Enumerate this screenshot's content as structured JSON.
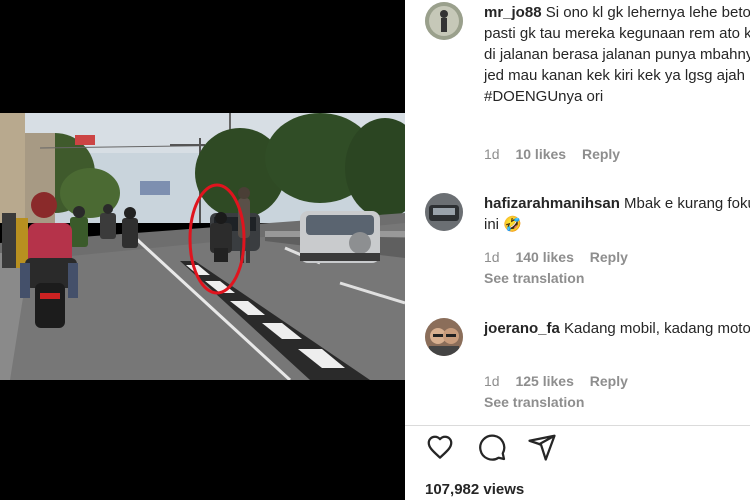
{
  "comments": [
    {
      "username": "mr_jo88",
      "text": "Si ono kl gk lehernya lehe beton pasti gk tau mereka kegunaan rem ato kl di jalanan berasa jalanan punya mbahnya jed mau kanan kek kiri kek ya lgsg ajah #DOENGUnya ori",
      "age": "1d",
      "likes": "10 likes",
      "reply": "Reply"
    },
    {
      "username": "hafizarahmanihsan",
      "text": "Mbak e kurang fokus ini 🤣",
      "age": "1d",
      "likes": "140 likes",
      "reply": "Reply",
      "see_translation": "See translation"
    },
    {
      "username": "joerano_fa",
      "text": "Kadang mobil, kadang motor",
      "age": "1d",
      "likes": "125 likes",
      "reply": "Reply",
      "see_translation": "See translation"
    }
  ],
  "actions": {
    "like_icon": "heart-icon",
    "comment_icon": "speech-bubble-icon",
    "share_icon": "paper-plane-icon"
  },
  "views": "107,982 views",
  "colors": {
    "text": "#262626",
    "muted": "#8e8e8e",
    "highlight_circle": "#e0141e"
  }
}
